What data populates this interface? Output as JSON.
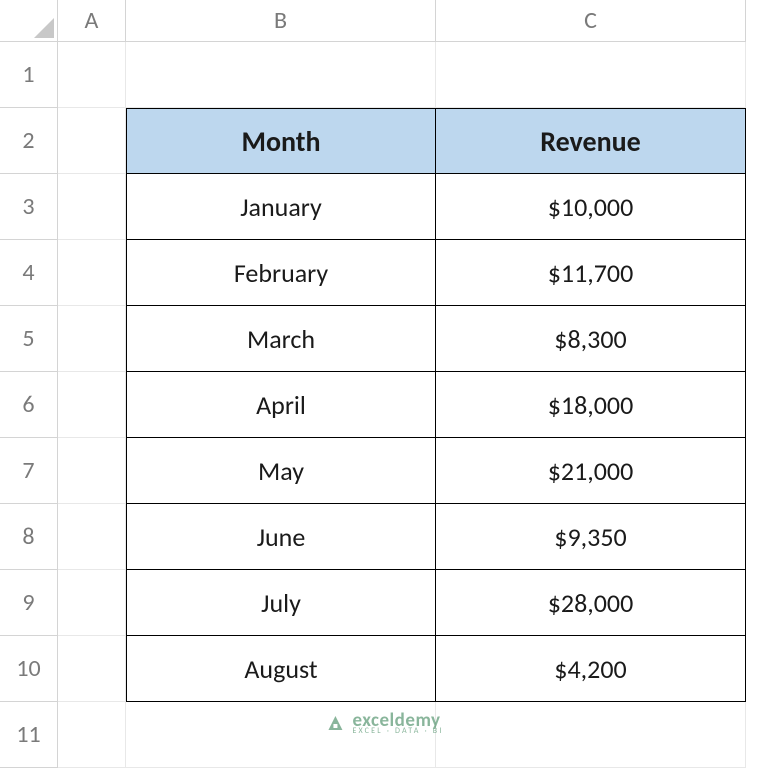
{
  "columns": [
    "A",
    "B",
    "C"
  ],
  "rows": [
    "1",
    "2",
    "3",
    "4",
    "5",
    "6",
    "7",
    "8",
    "9",
    "10",
    "11"
  ],
  "table": {
    "headers": {
      "month": "Month",
      "revenue": "Revenue"
    },
    "data": [
      {
        "month": "January",
        "revenue": "$10,000"
      },
      {
        "month": "February",
        "revenue": "$11,700"
      },
      {
        "month": "March",
        "revenue": "$8,300"
      },
      {
        "month": "April",
        "revenue": "$18,000"
      },
      {
        "month": "May",
        "revenue": "$21,000"
      },
      {
        "month": "June",
        "revenue": "$9,350"
      },
      {
        "month": "July",
        "revenue": "$28,000"
      },
      {
        "month": "August",
        "revenue": "$4,200"
      }
    ]
  },
  "watermark": {
    "brand": "exceldemy",
    "tagline": "EXCEL · DATA · BI"
  },
  "chart_data": {
    "type": "table",
    "categories": [
      "January",
      "February",
      "March",
      "April",
      "May",
      "June",
      "July",
      "August"
    ],
    "values": [
      10000,
      11700,
      8300,
      18000,
      21000,
      9350,
      28000,
      4200
    ],
    "title": "",
    "xlabel": "Month",
    "ylabel": "Revenue"
  }
}
